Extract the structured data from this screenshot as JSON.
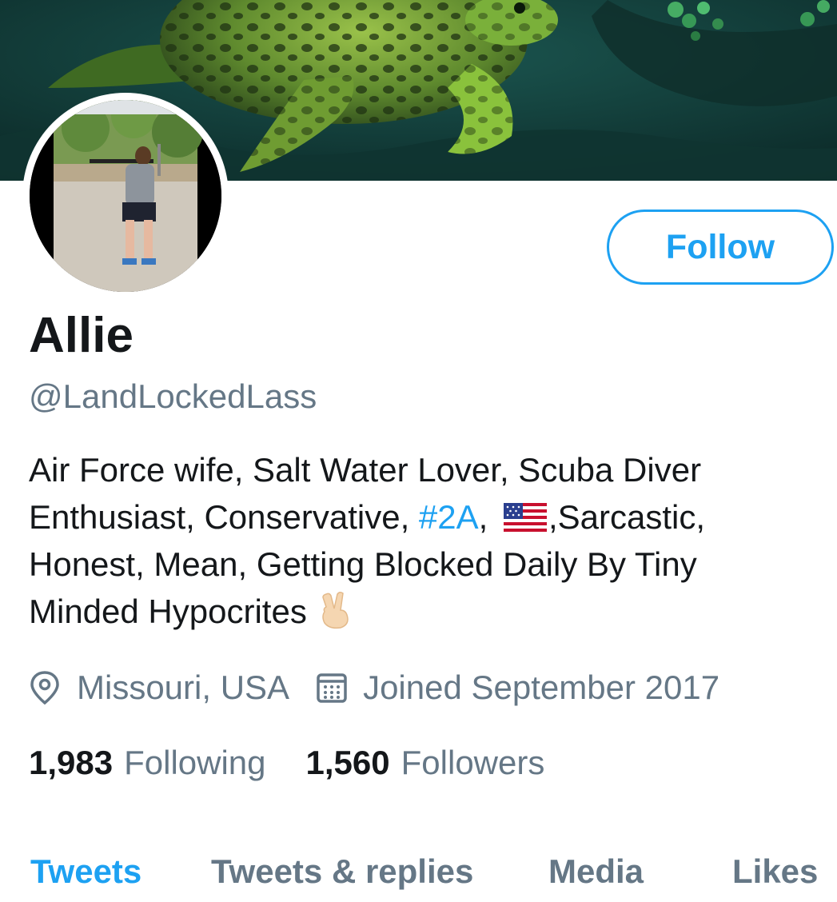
{
  "profile": {
    "name": "Allie",
    "handle": "@LandLockedLass",
    "follow_label": "Follow",
    "bio": {
      "line1": "Air Force wife, Salt Water Lover, Scuba Diver",
      "line2_a": "Enthusiast, Conservative, ",
      "hashtag": "#2A",
      "line2_b": ", ",
      "line2_c": ",Sarcastic,",
      "line3": "Honest, Mean, Getting Blocked Daily By Tiny",
      "line4": "Minded Hypocrites"
    },
    "location": "Missouri, USA",
    "joined": "Joined September 2017",
    "following_count": "1,983",
    "following_label": "Following",
    "followers_count": "1,560",
    "followers_label": "Followers"
  },
  "tabs": [
    {
      "label": "Tweets",
      "active": true
    },
    {
      "label": "Tweets & replies",
      "active": false
    },
    {
      "label": "Media",
      "active": false
    },
    {
      "label": "Likes",
      "active": false
    }
  ],
  "icons": {
    "location": "location-pin-icon",
    "joined": "calendar-icon",
    "flag": "us-flag-emoji",
    "peace": "victory-hand-emoji"
  },
  "colors": {
    "accent": "#1da1f2",
    "text": "#14171a",
    "secondary": "#657786"
  }
}
